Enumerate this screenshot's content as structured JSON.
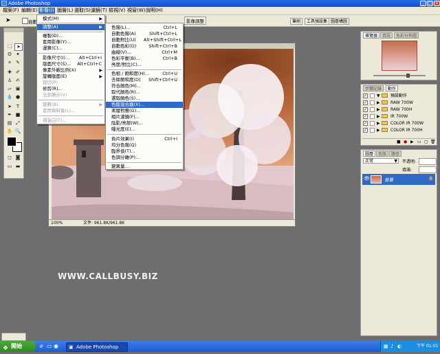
{
  "window": {
    "title": "Adobe Photoshop"
  },
  "menubar": [
    "檔案(F)",
    "編輯(E)",
    "影像(I)",
    "圖層(L)",
    "選取(S)",
    "濾鏡(T)",
    "檢視(V)",
    "視窗(W)",
    "說明(H)"
  ],
  "optionsbar": {
    "label": "自動",
    "tabs": [
      "筆刷",
      "工具預設集",
      "圖層構圖"
    ]
  },
  "image_menu": {
    "items": [
      {
        "label": "模式(M)",
        "shortcut": "",
        "submenu": true
      },
      {
        "label": "調整(A)",
        "shortcut": "",
        "submenu": true,
        "highlighted": true
      },
      {
        "label": "複製(D)..."
      },
      {
        "label": "套用影像(Y)..."
      },
      {
        "label": "運算(C)..."
      },
      {
        "label": "影像尺寸(I)...",
        "shortcut": "Alt+Ctrl+I"
      },
      {
        "label": "版面尺寸(S)...",
        "shortcut": "Alt+Ctrl+C"
      },
      {
        "label": "像素外觀比例(X)",
        "submenu": true
      },
      {
        "label": "旋轉版面(E)",
        "submenu": true
      },
      {
        "label": "裁切(P)",
        "disabled": true
      },
      {
        "label": "修剪(R)..."
      },
      {
        "label": "全部顯示(V)",
        "disabled": true
      },
      {
        "label": "變數(B)",
        "disabled": true,
        "submenu": true
      },
      {
        "label": "套用資料集(L)...",
        "disabled": true
      },
      {
        "label": "補漏白(T)...",
        "disabled": true
      }
    ]
  },
  "adjust_menu": {
    "items": [
      {
        "label": "色階(L)...",
        "shortcut": "Ctrl+L"
      },
      {
        "label": "自動色階(A)",
        "shortcut": "Shift+Ctrl+L"
      },
      {
        "label": "自動對比(U)",
        "shortcut": "Alt+Shift+Ctrl+L"
      },
      {
        "label": "自動色彩(O)",
        "shortcut": "Shift+Ctrl+B"
      },
      {
        "label": "曲線(V)...",
        "shortcut": "Ctrl+M"
      },
      {
        "label": "色彩平衡(B)...",
        "shortcut": "Ctrl+B"
      },
      {
        "label": "亮度/對比(C)...",
        "shortcut": ""
      },
      {
        "label": "色相 / 飽和度(H)...",
        "shortcut": "Ctrl+U"
      },
      {
        "label": "去除飽和度(D)",
        "shortcut": "Shift+Ctrl+U"
      },
      {
        "label": "符合顏色(M)..."
      },
      {
        "label": "取代顏色(R)..."
      },
      {
        "label": "選取顏色(S)..."
      },
      {
        "label": "色版混合器(X)...",
        "highlighted": true
      },
      {
        "label": "漸層對應(G)..."
      },
      {
        "label": "相片濾鏡(F)..."
      },
      {
        "label": "陰影/亮部(W)..."
      },
      {
        "label": "曝光度(E)..."
      },
      {
        "label": "負片效果(I)",
        "shortcut": "Ctrl+I"
      },
      {
        "label": "均分色階(Q)"
      },
      {
        "label": "臨界值(T)..."
      },
      {
        "label": "色調分離(P)..."
      },
      {
        "label": "變異量..."
      }
    ]
  },
  "document": {
    "tab_label": "影像調整",
    "zoom": "100%",
    "status": "文件: 961.8K/961.8K"
  },
  "navigator": {
    "tabs": [
      "導覽器",
      "資訊",
      "色彩分佈圖"
    ]
  },
  "actions": {
    "tabs": [
      "步驟記錄",
      "動作"
    ],
    "items": [
      "預設動作",
      "RAW 700W",
      "RAW 700H",
      "IR 700W",
      "COLOR IR 700W",
      "COLOR IR 700H"
    ]
  },
  "layers": {
    "tabs": [
      "圖層",
      "色版",
      "路徑"
    ],
    "blend": "正常",
    "opacity_label": "不透明:",
    "fill_label": "填滿:",
    "layer_name": "背景"
  },
  "taskbar": {
    "start": "開始",
    "task": "Adobe Photoshop",
    "time": "下午 01:01"
  },
  "watermark": "WWW.CALLBUSY.BIZ",
  "colors": {
    "menu_highlight": "#316ac5",
    "titlebar": "#0b4fd6",
    "panel_bg": "#ece9d8"
  }
}
